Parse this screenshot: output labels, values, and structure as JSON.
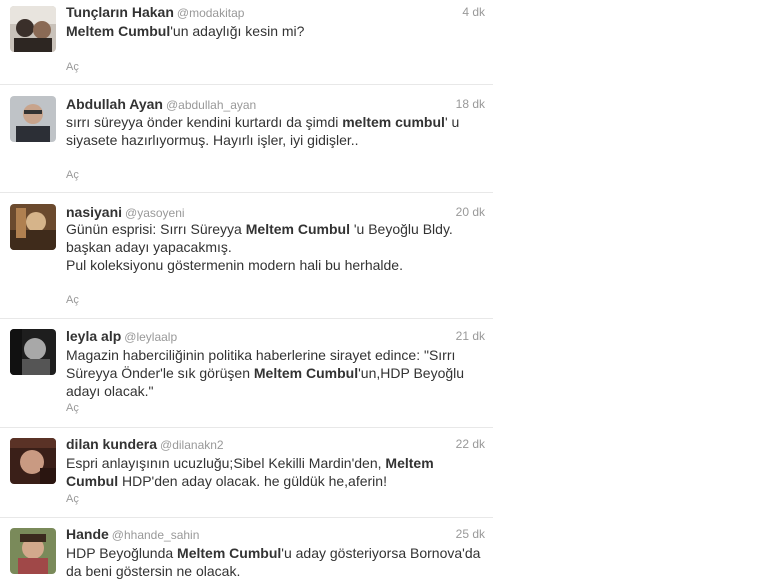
{
  "tweets": [
    {
      "fullname": "Tunçların Hakan",
      "username": "@modakitap",
      "time": "4 dk",
      "segments": [
        {
          "t": "Meltem Cumbul",
          "b": true
        },
        {
          "t": "'un adaylığı kesin mi?",
          "b": false
        }
      ],
      "expand": "Aç"
    },
    {
      "fullname": "Abdullah Ayan",
      "username": "@abdullah_ayan",
      "time": "18 dk",
      "segments": [
        {
          "t": "sırrı süreyya önder kendini kurtardı da şimdi ",
          "b": false
        },
        {
          "t": "meltem cumbul",
          "b": true
        },
        {
          "t": "' u siyasete hazırlıyormuş. Hayırlı işler, iyi gidişler..",
          "b": false
        }
      ],
      "expand": "Aç"
    },
    {
      "fullname": "nasiyani",
      "username": "@yasoyeni",
      "time": "20 dk",
      "segments": [
        {
          "t": "Günün esprisi: Sırrı Süreyya ",
          "b": false
        },
        {
          "t": "Meltem Cumbul",
          "b": true
        },
        {
          "t": " 'u Beyoğlu Bldy. başkan adayı yapacakmış.\nPul koleksiyonu göstermenin modern hali bu herhalde.",
          "b": false
        }
      ],
      "expand": "Aç"
    },
    {
      "fullname": "leyla alp",
      "username": "@leylaalp",
      "time": "21 dk",
      "segments": [
        {
          "t": "Magazin haberciliğinin politika haberlerine sirayet edince: \"Sırrı Süreyya Önder'le sık görüşen ",
          "b": false
        },
        {
          "t": "Meltem Cumbul",
          "b": true
        },
        {
          "t": "'un,HDP Beyoğlu adayı olacak.\"",
          "b": false
        }
      ],
      "expand": "Aç"
    },
    {
      "fullname": "dilan kundera",
      "username": "@dilanakn2",
      "time": "22 dk",
      "segments": [
        {
          "t": "Espri anlayışının ucuzluğu;Sibel Kekilli Mardin'den, ",
          "b": false
        },
        {
          "t": "Meltem Cumbul",
          "b": true
        },
        {
          "t": " HDP'den aday olacak. he güldük he,aferin!",
          "b": false
        }
      ],
      "expand": "Aç"
    },
    {
      "fullname": "Hande",
      "username": "@hhande_sahin",
      "time": "25 dk",
      "segments": [
        {
          "t": "HDP Beyoğlunda ",
          "b": false
        },
        {
          "t": "Meltem Cumbul",
          "b": true
        },
        {
          "t": "'u aday gösteriyorsa Bornova'da da beni göstersin ne olacak.",
          "b": false
        }
      ],
      "expand": ""
    }
  ],
  "colors": {
    "text": "#333333",
    "muted": "#999999",
    "divider": "#e8e8e8"
  },
  "icons": [
    "avatar-photo",
    "avatar-photo",
    "avatar-photo",
    "avatar-photo",
    "avatar-photo",
    "avatar-photo"
  ]
}
